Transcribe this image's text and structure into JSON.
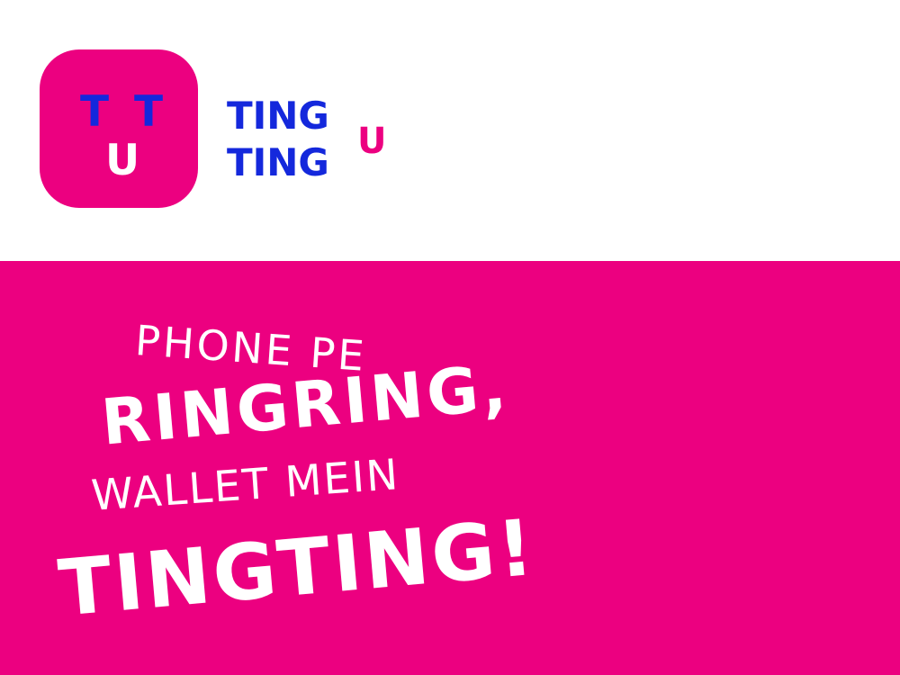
{
  "logo": {
    "icon_letters": [
      "T",
      "T",
      "U"
    ],
    "wordmark_lines": [
      "TING",
      "TING"
    ],
    "wordmark_suffix": "U",
    "colors": {
      "brand_pink": "#ec0080",
      "brand_blue": "#1428dc",
      "white": "#ffffff"
    }
  },
  "banner": {
    "lines": [
      "PHONE PE",
      "RINGRING,",
      "WALLET MEIN",
      "TINGTING!"
    ]
  }
}
